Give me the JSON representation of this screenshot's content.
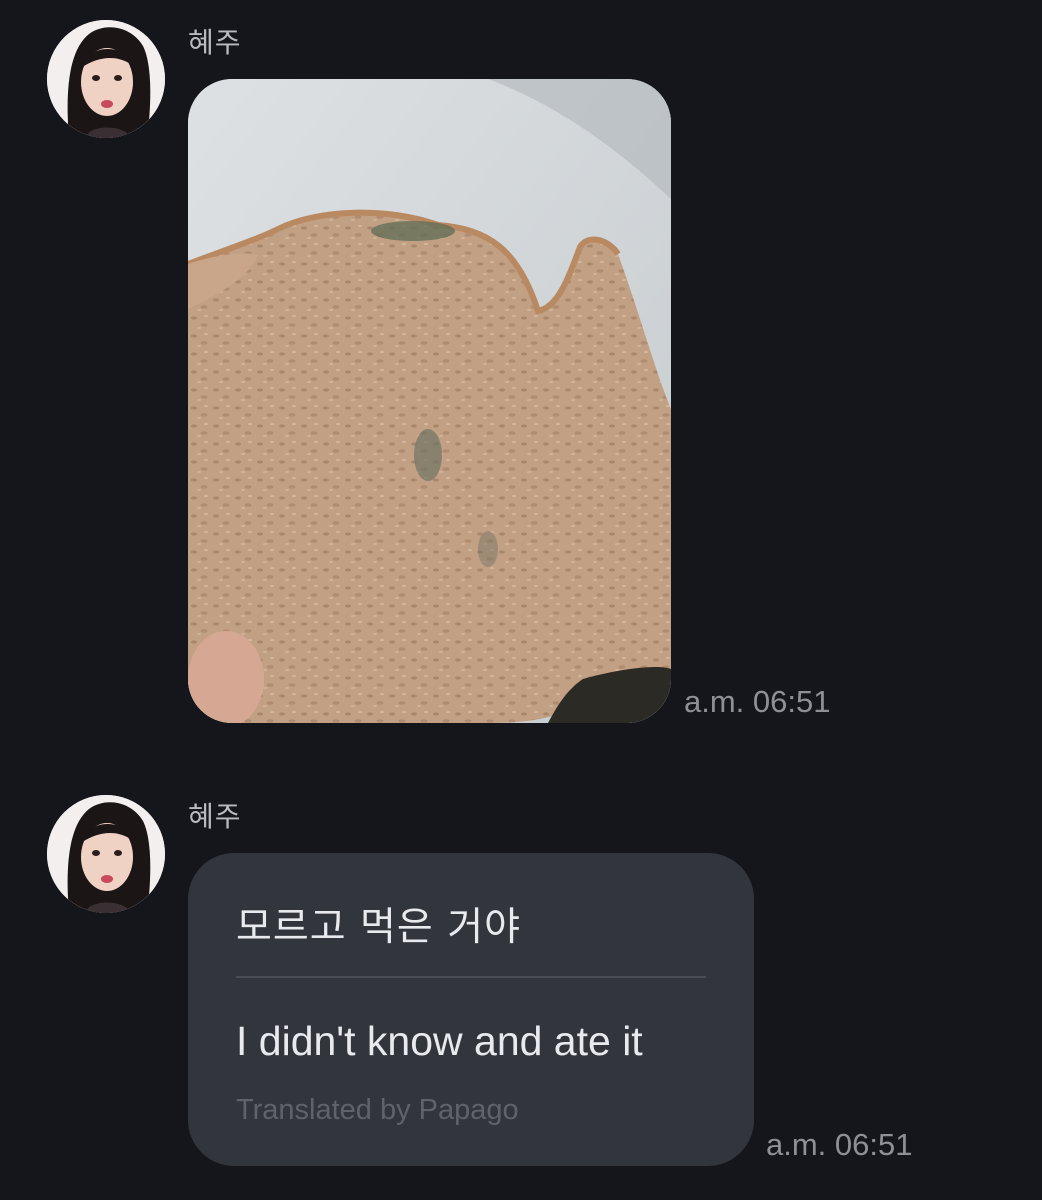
{
  "messages": [
    {
      "sender": "혜주",
      "type": "image",
      "image": "moldy-bread-slice-photo",
      "time": "a.m. 06:51"
    },
    {
      "sender": "혜주",
      "type": "text",
      "original_text": "모르고 먹은 거야",
      "translated_text": "I didn't know and ate it",
      "translation_credit": "Translated by Papago",
      "time": "a.m. 06:51"
    }
  ],
  "icons": {
    "avatar": "profile-photo-avatar"
  },
  "colors": {
    "background": "#15161b",
    "bubble": "#33353d",
    "name_text": "#b9bbc2",
    "time_text": "#8e9096",
    "credit_text": "#5f626b"
  }
}
